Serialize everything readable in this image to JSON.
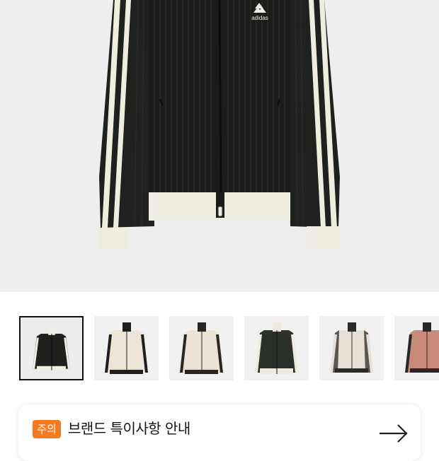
{
  "product": {
    "hero_image": "black knit track jacket with cream cuffs and three white stripes",
    "logo_text": "adidas",
    "colors": {
      "jacket": "#1d1f1d",
      "trim": "#efece2",
      "background": "#eeeeee"
    }
  },
  "thumbnails": [
    {
      "name": "black",
      "body": "#1e201e",
      "stripe": "#f1eee4",
      "collar": "#f1eee4",
      "hem": "#f1eee4",
      "selected": true
    },
    {
      "name": "cream-black",
      "body": "#ece4d6",
      "stripe": "#1e1e1e",
      "collar": "#1e1e1e",
      "hem": "#1e1e1e",
      "selected": false
    },
    {
      "name": "cream-brown",
      "body": "#ebe3d5",
      "stripe": "#2a2622",
      "collar": "#2a2622",
      "hem": "#2a2622",
      "selected": false
    },
    {
      "name": "dark-green",
      "body": "#2a2f29",
      "stripe": "#eeeadf",
      "collar": "#eeeadf",
      "hem": "#eeeadf",
      "selected": false
    },
    {
      "name": "cream-grey",
      "body": "#e8e0d6",
      "stripe": "#4a4644",
      "collar": "#2a2a2a",
      "hem": "#2a2a2a",
      "selected": false
    },
    {
      "name": "pink",
      "body": "#c98a7c",
      "stripe": "#2a2624",
      "collar": "#2a2624",
      "hem": "#2a2624",
      "selected": false
    }
  ],
  "notice": {
    "badge": "주의",
    "title": "브랜드 특이사항 안내",
    "badge_color": "#f47b20"
  }
}
